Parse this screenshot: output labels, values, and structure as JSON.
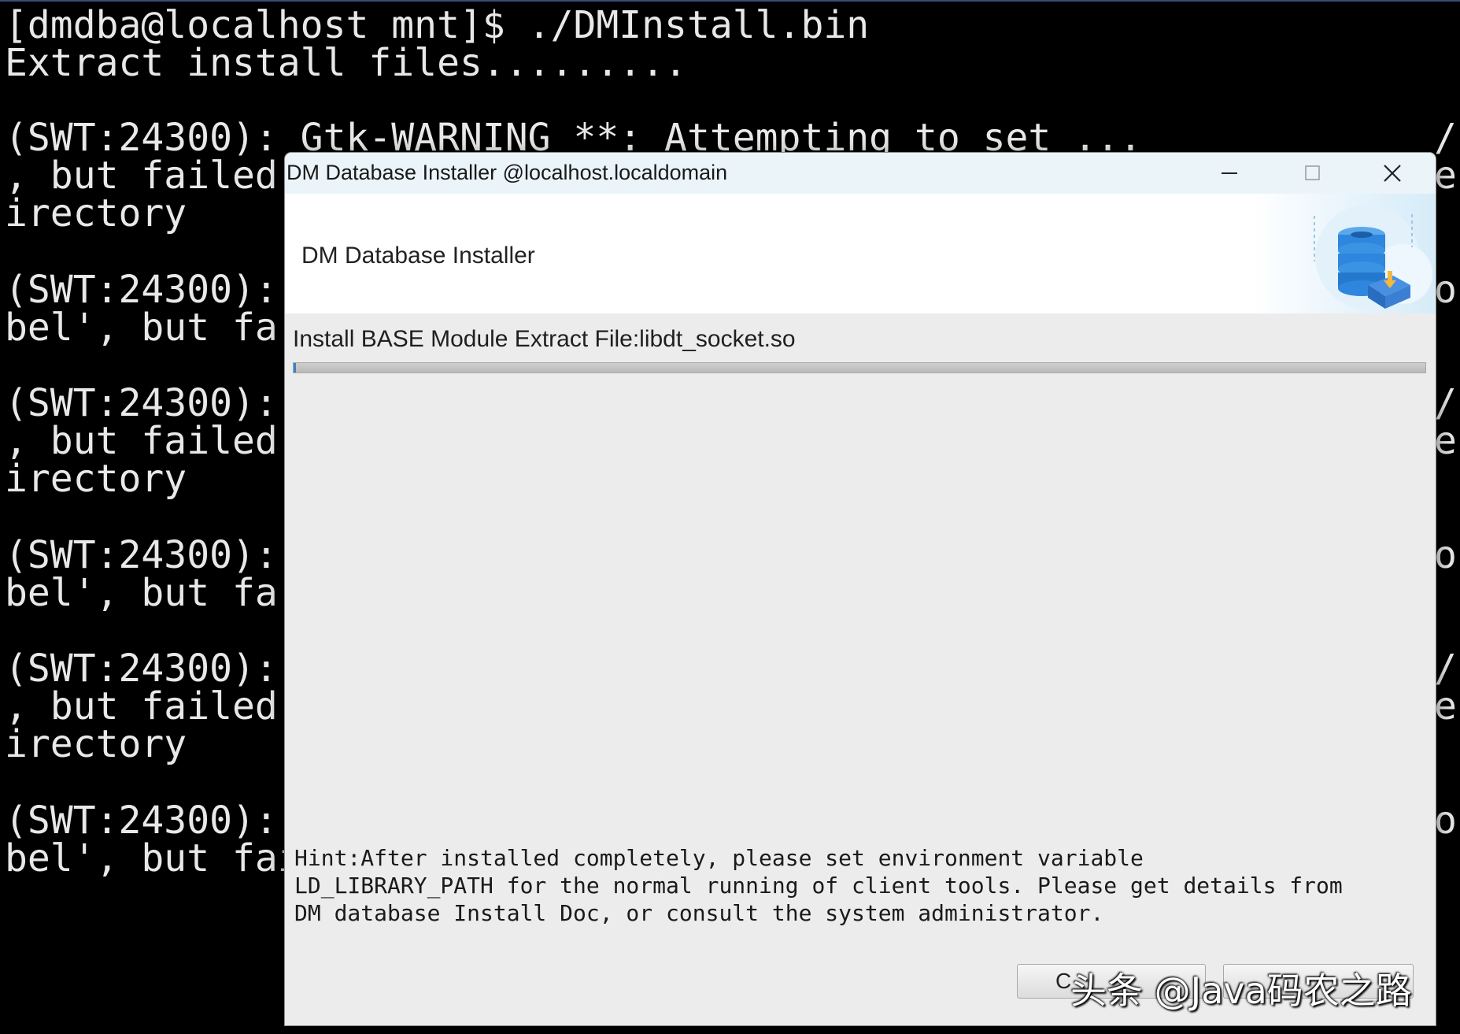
{
  "terminal": {
    "lines": [
      "[dmdba@localhost mnt]$ ./DMInstall.bin",
      "Extract install files.........",
      "(SWT:24300): Gtk-WARNING **: Attempting to set ...",
      ", but failed",
      "irectory",
      "(SWT:24300):",
      "bel', but fa:",
      "(SWT:24300):",
      ", but failed",
      "irectory",
      "(SWT:24300):",
      "bel', but fa:",
      "(SWT:24300):",
      ", but failed",
      "irectory",
      "(SWT:24300):",
      "bel', but failed: No such file or directory"
    ],
    "right_chars": [
      "/",
      "e",
      "o",
      "/",
      "e",
      "o",
      "/",
      "e",
      "o"
    ]
  },
  "window": {
    "title": "DM Database Installer @localhost.localdomain",
    "banner_title": "DM Database Installer",
    "status": "Install BASE Module  Extract File:libdt_socket.so",
    "progress": 0.002,
    "hint": "Hint:After installed completely, please set environment variable\nLD_LIBRARY_PATH for the normal running of client tools. Please get details from\nDM database Install Doc, or consult the system administrator.",
    "cancel_label": "C",
    "icons": {
      "minimize": "minimize-icon",
      "maximize": "maximize-icon",
      "close": "close-icon",
      "logo": "database-install-icon"
    },
    "colors": {
      "titlebar": "#eaf4f9",
      "progress": "#3c7fc4",
      "logo": "#2e86de"
    }
  },
  "watermark": "头条 @Java码农之路"
}
